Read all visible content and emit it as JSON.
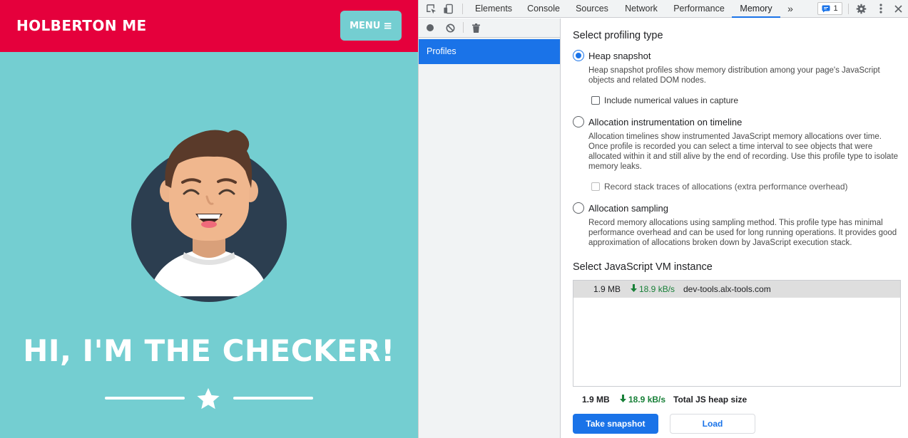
{
  "site": {
    "brand": "HOLBERTON ME",
    "menu_label": "MENU",
    "menu_icon": "hamburger-icon",
    "hero_title": "HI, I'M THE CHECKER!",
    "divider_icon": "star-icon",
    "colors": {
      "header": "#e5003c",
      "background": "#74ced1",
      "text": "#ffffff"
    }
  },
  "devtools": {
    "toolbar": {
      "inspect_icon": "inspect-element-icon",
      "device_icon": "device-toolbar-icon",
      "tabs": [
        {
          "label": "Elements",
          "active": false
        },
        {
          "label": "Console",
          "active": false
        },
        {
          "label": "Network",
          "active": false
        },
        {
          "label": "Performance",
          "active": false
        },
        {
          "label": "Memory",
          "active": true
        }
      ],
      "sources_label": "Sources",
      "more_tabs": "»",
      "issues_count": "1",
      "settings_icon": "gear-icon",
      "more_icon": "kebab-menu-icon"
    },
    "sidebar": {
      "record_icon": "record-icon",
      "clear_icon": "clear-icon",
      "trash_icon": "trash-icon",
      "items": [
        {
          "label": "Profiles",
          "selected": true
        }
      ]
    },
    "main": {
      "profiling_title": "Select profiling type",
      "options": [
        {
          "label": "Heap snapshot",
          "checked": true,
          "desc": "Heap snapshot profiles show memory distribution among your page's JavaScript objects and related DOM nodes.",
          "checkbox": {
            "label": "Include numerical values in capture",
            "checked": false,
            "disabled": false
          }
        },
        {
          "label": "Allocation instrumentation on timeline",
          "checked": false,
          "desc": "Allocation timelines show instrumented JavaScript memory allocations over time. Once profile is recorded you can select a time interval to see objects that were allocated within it and still alive by the end of recording. Use this profile type to isolate memory leaks.",
          "checkbox": {
            "label": "Record stack traces of allocations (extra performance overhead)",
            "checked": false,
            "disabled": true
          }
        },
        {
          "label": "Allocation sampling",
          "checked": false,
          "desc": "Record memory allocations using sampling method. This profile type has minimal performance overhead and can be used for long running operations. It provides good approximation of allocations broken down by JavaScript execution stack."
        }
      ],
      "vm_title": "Select JavaScript VM instance",
      "vm_instances": [
        {
          "size": "1.9 MB",
          "rate": "18.9 kB/s",
          "url": "dev-tools.alx-tools.com"
        }
      ],
      "footer": {
        "size": "1.9 MB",
        "rate": "18.9 kB/s",
        "label": "Total JS heap size"
      },
      "take_snapshot": "Take snapshot",
      "load": "Load"
    },
    "colors": {
      "accent": "#1a73e8",
      "rate_green": "#188038"
    }
  }
}
